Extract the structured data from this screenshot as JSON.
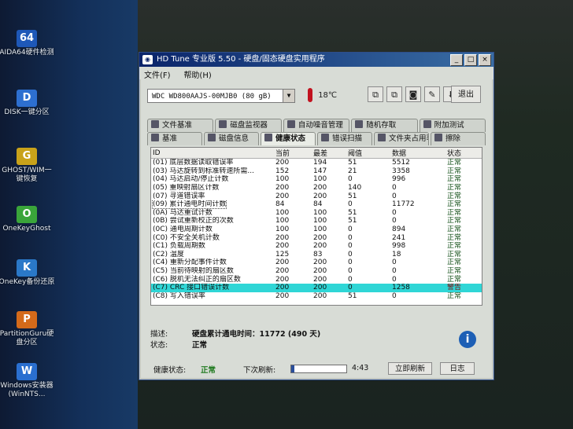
{
  "desktop": {
    "icons": [
      {
        "label": "AIDA64硬件检测",
        "glyph": "64"
      },
      {
        "label": "DISK一键分区",
        "glyph": "D"
      },
      {
        "label": "GHOST/WIM一键恢复",
        "glyph": "G"
      },
      {
        "label": "OneKeyGhost",
        "glyph": "O"
      },
      {
        "label": "OneKey备份还原",
        "glyph": "K"
      },
      {
        "label": "PartitionGuru硬盘分区",
        "glyph": "P"
      },
      {
        "label": "Windows安装器(WinNTS...",
        "glyph": "W"
      }
    ]
  },
  "window": {
    "title": "HD Tune 专业版 5.50 - 硬盘/固态硬盘实用程序",
    "controls": {
      "minimize": "_",
      "maximize": "□",
      "close": "×"
    },
    "menu": [
      "文件(F)",
      "帮助(H)"
    ],
    "drive": "WDC WD800AAJS-00MJB0 (80 gB)",
    "temperature": "18℃",
    "exit_label": "退出",
    "tabs_row1": [
      "文件基准",
      "磁盘监视器",
      "自动噪音管理",
      "随机存取",
      "附加测试"
    ],
    "tabs_row2": [
      "基准",
      "磁盘信息",
      "健康状态",
      "错误扫描",
      "文件夹占用率",
      "擦除"
    ],
    "active_tab": "健康状态"
  },
  "health_table": {
    "headers": [
      "ID",
      "当前",
      "最差",
      "阈值",
      "数据",
      "状态"
    ],
    "rows": [
      {
        "id": "(01) 底层数据读取错误率",
        "cur": "200",
        "worst": "194",
        "thr": "51",
        "data": "5512",
        "status": "正常"
      },
      {
        "id": "(03) 马达旋转到标准转速所需...",
        "cur": "152",
        "worst": "147",
        "thr": "21",
        "data": "3358",
        "status": "正常"
      },
      {
        "id": "(04) 马达启动/停止计数",
        "cur": "100",
        "worst": "100",
        "thr": "0",
        "data": "996",
        "status": "正常"
      },
      {
        "id": "(05) 重映射扇区计数",
        "cur": "200",
        "worst": "200",
        "thr": "140",
        "data": "0",
        "status": "正常"
      },
      {
        "id": "(07) 寻道错误率",
        "cur": "200",
        "worst": "200",
        "thr": "51",
        "data": "0",
        "status": "正常"
      },
      {
        "id": "(09) 累计通电时间计数",
        "cur": "84",
        "worst": "84",
        "thr": "0",
        "data": "11772",
        "status": "正常"
      },
      {
        "id": "(0A) 马达重试计数",
        "cur": "100",
        "worst": "100",
        "thr": "51",
        "data": "0",
        "status": "正常"
      },
      {
        "id": "(0B) 尝试重新校正的次数",
        "cur": "100",
        "worst": "100",
        "thr": "51",
        "data": "0",
        "status": "正常"
      },
      {
        "id": "(0C) 通电周期计数",
        "cur": "100",
        "worst": "100",
        "thr": "0",
        "data": "894",
        "status": "正常"
      },
      {
        "id": "(C0) 不安全关机计数",
        "cur": "200",
        "worst": "200",
        "thr": "0",
        "data": "241",
        "status": "正常"
      },
      {
        "id": "(C1) 负载周期数",
        "cur": "200",
        "worst": "200",
        "thr": "0",
        "data": "998",
        "status": "正常"
      },
      {
        "id": "(C2) 温度",
        "cur": "125",
        "worst": "83",
        "thr": "0",
        "data": "18",
        "status": "正常"
      },
      {
        "id": "(C4) 重新分配事件计数",
        "cur": "200",
        "worst": "200",
        "thr": "0",
        "data": "0",
        "status": "正常"
      },
      {
        "id": "(C5) 当前待映射的扇区数",
        "cur": "200",
        "worst": "200",
        "thr": "0",
        "data": "0",
        "status": "正常"
      },
      {
        "id": "(C6) 脱机无法纠正的扇区数",
        "cur": "200",
        "worst": "200",
        "thr": "0",
        "data": "0",
        "status": "正常"
      },
      {
        "id": "(C7) CRC 接口错误计数",
        "cur": "200",
        "worst": "200",
        "thr": "0",
        "data": "1258",
        "status": "警告"
      },
      {
        "id": "(C8) 写入错误率",
        "cur": "200",
        "worst": "200",
        "thr": "51",
        "data": "0",
        "status": "正常"
      }
    ]
  },
  "details": {
    "desc_label": "描述:",
    "desc_value": "硬盘累计通电时间：11772 (490 天)",
    "status_label": "状态:",
    "status_value": "正常"
  },
  "statusbar": {
    "health_label": "健康状态:",
    "health_value": "正常",
    "next_refresh_label": "下次刷新:",
    "progress": 0.05,
    "countdown": "4:43",
    "refresh_now": "立即刷新",
    "log": "日志"
  }
}
